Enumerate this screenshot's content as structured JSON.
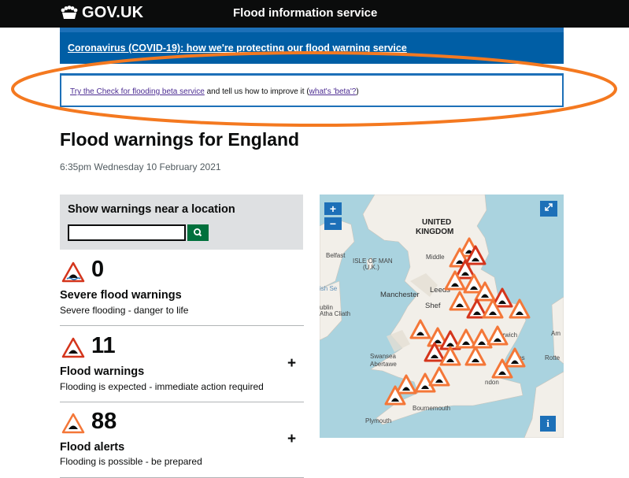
{
  "header": {
    "logo_text": "GOV.UK",
    "service_name": "Flood information service"
  },
  "covid_banner": {
    "link_text": "Coronavirus (COVID-19): how we're protecting our flood warning service"
  },
  "beta_banner": {
    "link_text": "Try the Check for flooding beta service",
    "middle_text": " and tell us how to improve it (",
    "beta_link_text": "what's 'beta'?",
    "end_text": ")"
  },
  "page": {
    "title": "Flood warnings for England",
    "timestamp": "6:35pm Wednesday 10 February 2021"
  },
  "search": {
    "title": "Show warnings near a location",
    "input_value": "",
    "button_icon": "search-icon"
  },
  "warnings": [
    {
      "count": "0",
      "label": "Severe flood warnings",
      "description": "Severe flooding - danger to life",
      "icon": "severe-flood-warning-icon"
    },
    {
      "count": "11",
      "label": "Flood warnings",
      "description": "Flooding is expected - immediate action required",
      "icon": "flood-warning-icon",
      "expand": "+"
    },
    {
      "count": "88",
      "label": "Flood alerts",
      "description": "Flooding is possible - be prepared",
      "icon": "flood-alert-icon",
      "expand": "+"
    }
  ],
  "map": {
    "zoom_in": "+",
    "zoom_out": "−",
    "info": "i",
    "labels": {
      "country_line1": "UNITED",
      "country_line2": "KINGDOM",
      "belfast": "Belfast",
      "isle_of_man_1": "ISLE OF MAN",
      "isle_of_man_2": "(U.K.)",
      "irish_sea": "ish Se",
      "ublin": "ublin",
      "ath_cliath": "Atha Cliath",
      "middle": "Middle",
      "leeds": "Leeds",
      "manchester": "Manchester",
      "shef": "Shef",
      "swansea": "Swansea",
      "abertawe": "Abertawe",
      "plymouth": "Plymouth",
      "bournemouth": "Bournemouth",
      "ips": "Ips",
      "rotte": "Rotte",
      "am": "Am",
      "norwich": "orwich",
      "london": "ndon"
    }
  },
  "colors": {
    "header_bg": "#0b0c0c",
    "covid_banner_bg": "#005ea5",
    "link_blue": "#1d70b8",
    "search_panel_bg": "#dee0e2",
    "search_button_bg": "#00703c",
    "warning_red": "#d4351c",
    "alert_orange": "#f47738",
    "annotation_orange": "#f47920"
  }
}
